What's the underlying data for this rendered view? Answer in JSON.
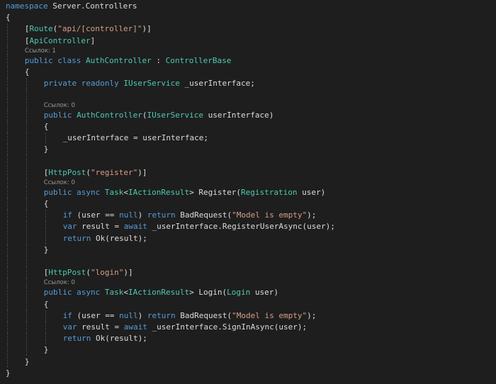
{
  "colors": {
    "background": "#1e1e1e",
    "keyword": "#569cd6",
    "type": "#4ec9b0",
    "string": "#d69d85",
    "text": "#dcdcdc",
    "codelens": "#9a9a9a"
  },
  "lines": [
    {
      "i": 0,
      "tokens": [
        [
          "k",
          "namespace"
        ],
        [
          "p",
          " Server.Controllers"
        ]
      ]
    },
    {
      "i": 0,
      "tokens": [
        [
          "p",
          "{"
        ]
      ]
    },
    {
      "i": 1,
      "tokens": [
        [
          "p",
          "["
        ],
        [
          "t",
          "Route"
        ],
        [
          "p",
          "("
        ],
        [
          "s",
          "\"api/[controller]\""
        ],
        [
          "p",
          ")]"
        ]
      ]
    },
    {
      "i": 1,
      "tokens": [
        [
          "p",
          "["
        ],
        [
          "t",
          "ApiController"
        ],
        [
          "p",
          "]"
        ]
      ]
    },
    {
      "i": 1,
      "lens": "Ссылок: 1"
    },
    {
      "i": 1,
      "tokens": [
        [
          "k",
          "public"
        ],
        [
          "p",
          " "
        ],
        [
          "k",
          "class"
        ],
        [
          "p",
          " "
        ],
        [
          "t",
          "AuthController"
        ],
        [
          "p",
          " : "
        ],
        [
          "t",
          "ControllerBase"
        ]
      ]
    },
    {
      "i": 1,
      "tokens": [
        [
          "p",
          "{"
        ]
      ]
    },
    {
      "i": 2,
      "tokens": [
        [
          "k",
          "private"
        ],
        [
          "p",
          " "
        ],
        [
          "k",
          "readonly"
        ],
        [
          "p",
          " "
        ],
        [
          "t",
          "IUserService"
        ],
        [
          "p",
          " _userInterface;"
        ]
      ]
    },
    {
      "i": 2,
      "tokens": []
    },
    {
      "i": 2,
      "lens": "Ссылок: 0"
    },
    {
      "i": 2,
      "tokens": [
        [
          "k",
          "public"
        ],
        [
          "p",
          " "
        ],
        [
          "t",
          "AuthController"
        ],
        [
          "p",
          "("
        ],
        [
          "t",
          "IUserService"
        ],
        [
          "p",
          " userInterface)"
        ]
      ]
    },
    {
      "i": 2,
      "tokens": [
        [
          "p",
          "{"
        ]
      ]
    },
    {
      "i": 3,
      "tokens": [
        [
          "p",
          "_userInterface = userInterface;"
        ]
      ]
    },
    {
      "i": 2,
      "tokens": [
        [
          "p",
          "}"
        ]
      ]
    },
    {
      "i": 2,
      "tokens": []
    },
    {
      "i": 2,
      "tokens": [
        [
          "p",
          "["
        ],
        [
          "t",
          "HttpPost"
        ],
        [
          "p",
          "("
        ],
        [
          "s",
          "\"register\""
        ],
        [
          "p",
          ")]"
        ]
      ]
    },
    {
      "i": 2,
      "lens": "Ссылок: 0"
    },
    {
      "i": 2,
      "tokens": [
        [
          "k",
          "public"
        ],
        [
          "p",
          " "
        ],
        [
          "k",
          "async"
        ],
        [
          "p",
          " "
        ],
        [
          "t",
          "Task"
        ],
        [
          "p",
          "<"
        ],
        [
          "t",
          "IActionResult"
        ],
        [
          "p",
          "> Register("
        ],
        [
          "t",
          "Registration"
        ],
        [
          "p",
          " user)"
        ]
      ]
    },
    {
      "i": 2,
      "tokens": [
        [
          "p",
          "{"
        ]
      ]
    },
    {
      "i": 3,
      "tokens": [
        [
          "k",
          "if"
        ],
        [
          "p",
          " (user == "
        ],
        [
          "k",
          "null"
        ],
        [
          "p",
          ") "
        ],
        [
          "k",
          "return"
        ],
        [
          "p",
          " BadRequest("
        ],
        [
          "s",
          "\"Model is empty\""
        ],
        [
          "p",
          ");"
        ]
      ]
    },
    {
      "i": 3,
      "tokens": [
        [
          "k",
          "var"
        ],
        [
          "p",
          " result = "
        ],
        [
          "k",
          "await"
        ],
        [
          "p",
          " _userInterface.RegisterUserAsync(user);"
        ]
      ]
    },
    {
      "i": 3,
      "tokens": [
        [
          "k",
          "return"
        ],
        [
          "p",
          " Ok(result);"
        ]
      ]
    },
    {
      "i": 2,
      "tokens": [
        [
          "p",
          "}"
        ]
      ]
    },
    {
      "i": 2,
      "tokens": []
    },
    {
      "i": 2,
      "tokens": [
        [
          "p",
          "["
        ],
        [
          "t",
          "HttpPost"
        ],
        [
          "p",
          "("
        ],
        [
          "s",
          "\"login\""
        ],
        [
          "p",
          ")]"
        ]
      ]
    },
    {
      "i": 2,
      "lens": "Ссылок: 0"
    },
    {
      "i": 2,
      "tokens": [
        [
          "k",
          "public"
        ],
        [
          "p",
          " "
        ],
        [
          "k",
          "async"
        ],
        [
          "p",
          " "
        ],
        [
          "t",
          "Task"
        ],
        [
          "p",
          "<"
        ],
        [
          "t",
          "IActionResult"
        ],
        [
          "p",
          "> Login("
        ],
        [
          "t",
          "Login"
        ],
        [
          "p",
          " user)"
        ]
      ]
    },
    {
      "i": 2,
      "tokens": [
        [
          "p",
          "{"
        ]
      ]
    },
    {
      "i": 3,
      "tokens": [
        [
          "k",
          "if"
        ],
        [
          "p",
          " (user == "
        ],
        [
          "k",
          "null"
        ],
        [
          "p",
          ") "
        ],
        [
          "k",
          "return"
        ],
        [
          "p",
          " BadRequest("
        ],
        [
          "s",
          "\"Model is empty\""
        ],
        [
          "p",
          ");"
        ]
      ]
    },
    {
      "i": 3,
      "tokens": [
        [
          "k",
          "var"
        ],
        [
          "p",
          " result = "
        ],
        [
          "k",
          "await"
        ],
        [
          "p",
          " _userInterface.SignInAsync(user);"
        ]
      ]
    },
    {
      "i": 3,
      "tokens": [
        [
          "k",
          "return"
        ],
        [
          "p",
          " Ok(result);"
        ]
      ]
    },
    {
      "i": 2,
      "tokens": [
        [
          "p",
          "}"
        ]
      ]
    },
    {
      "i": 1,
      "tokens": [
        [
          "p",
          "}"
        ]
      ]
    },
    {
      "i": 0,
      "tokens": [
        [
          "p",
          "}"
        ]
      ]
    }
  ]
}
